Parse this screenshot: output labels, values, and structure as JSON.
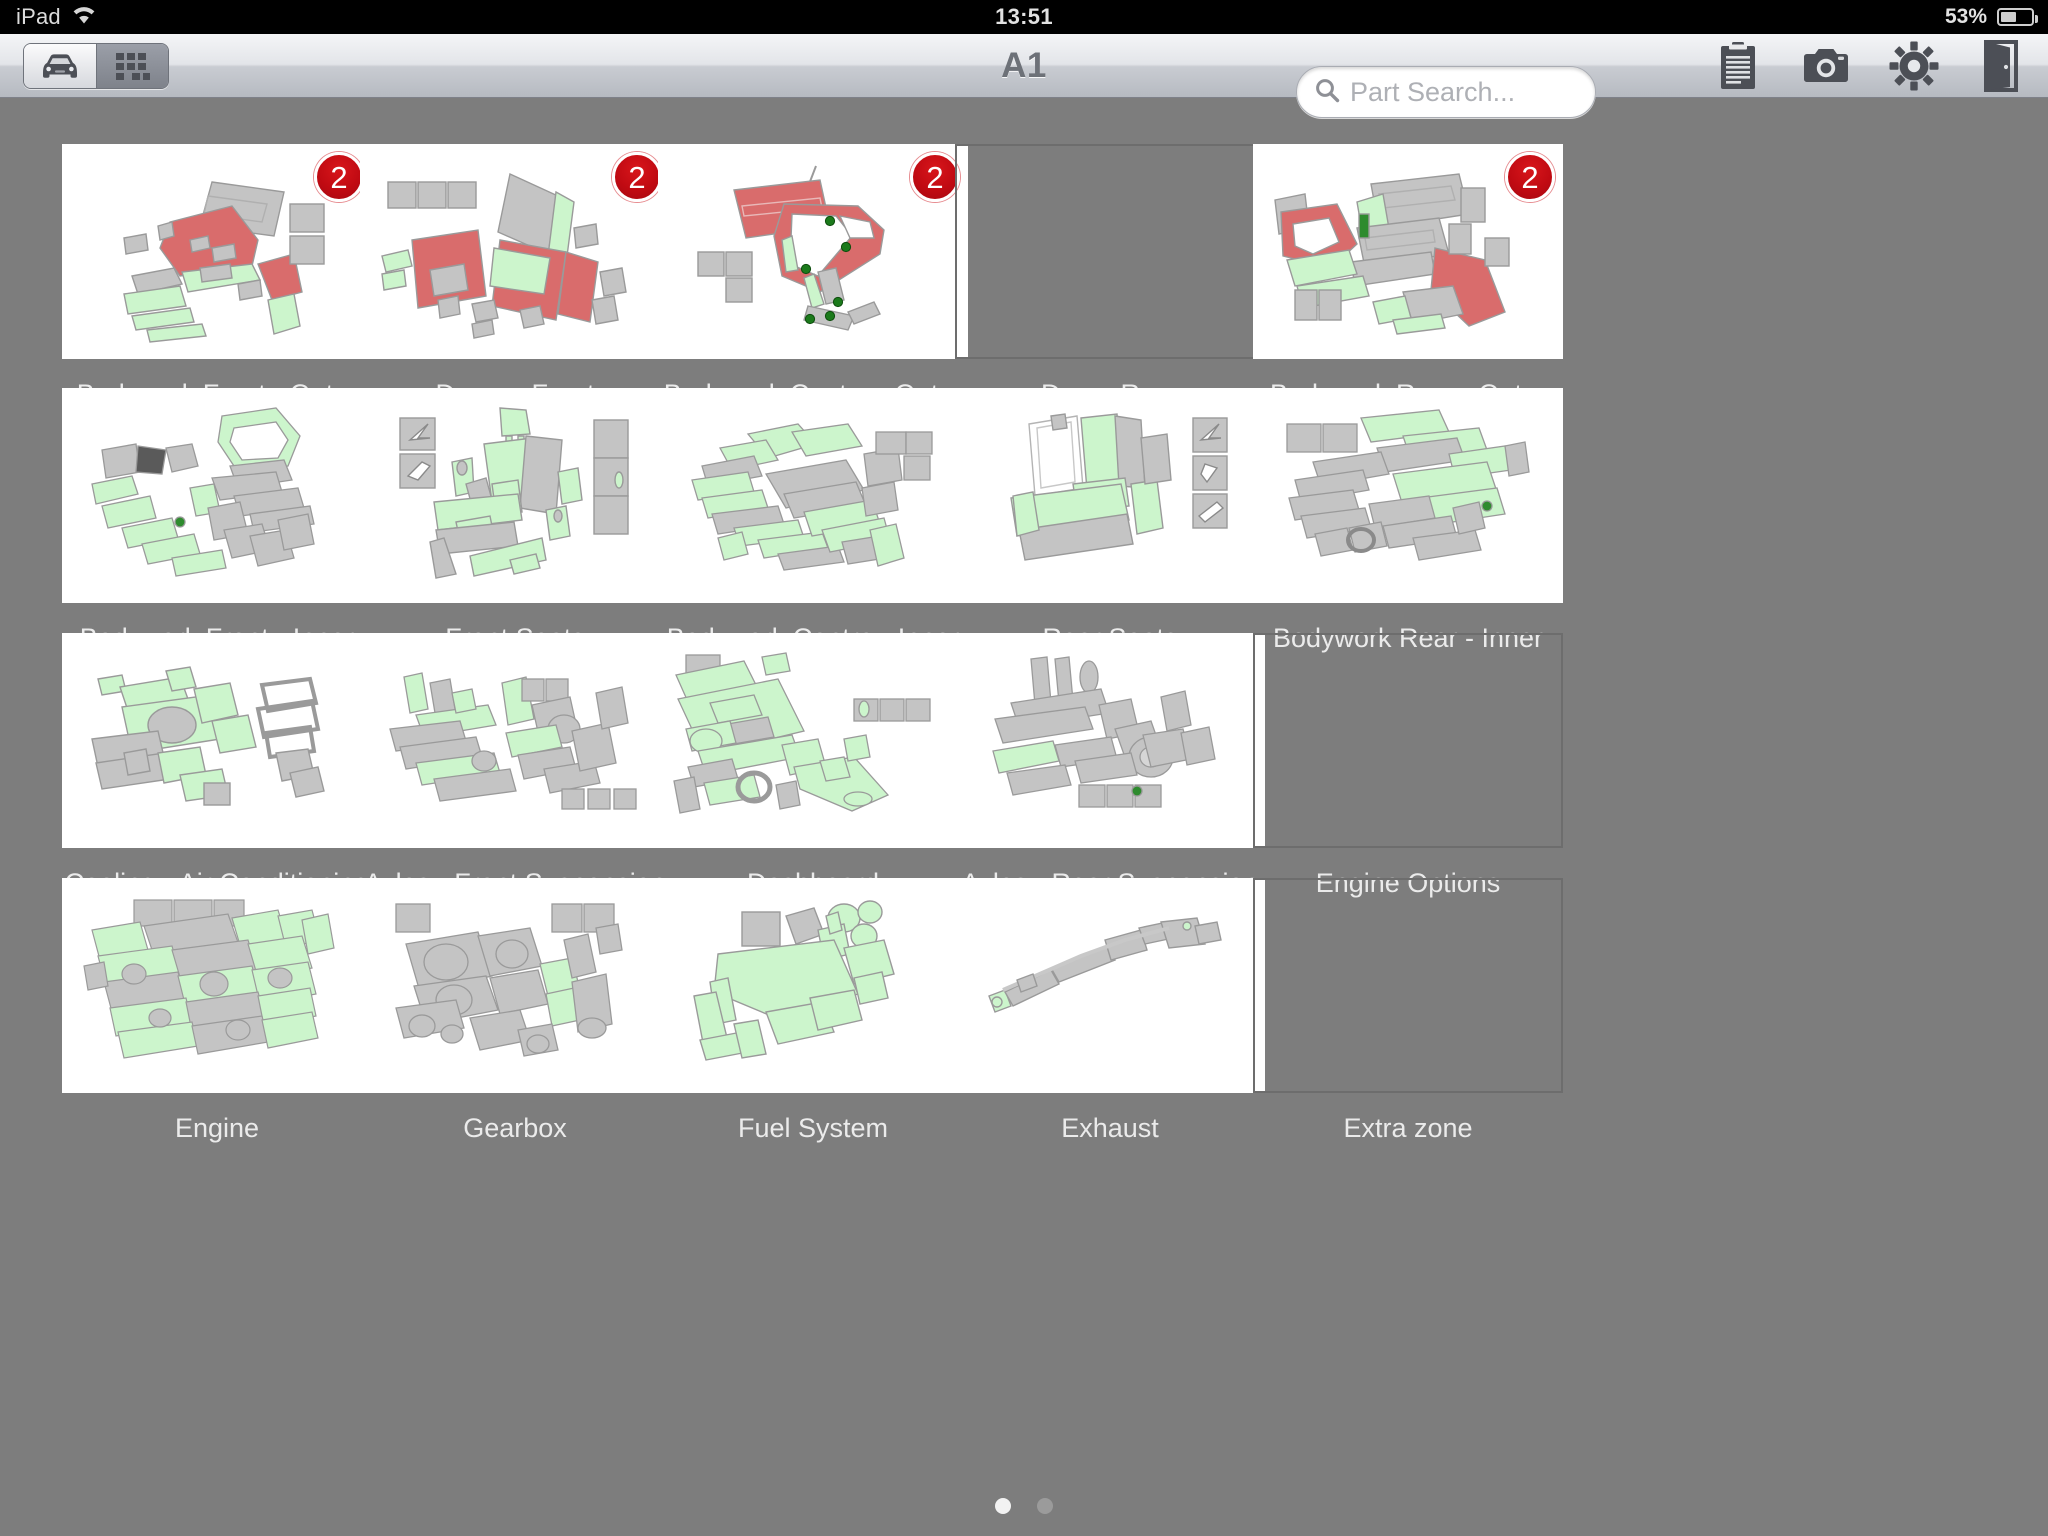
{
  "status_bar": {
    "device": "iPad",
    "wifi_icon": "wifi-icon",
    "time": "13:51",
    "battery_percent": "53%",
    "battery_level": 53
  },
  "toolbar": {
    "title": "A1",
    "segmented": {
      "options": [
        {
          "icon": "car-icon",
          "label": "Vehicle view",
          "selected": false
        },
        {
          "icon": "grid-icon",
          "label": "Grid view",
          "selected": true
        }
      ]
    },
    "search": {
      "placeholder": "Part Search...",
      "value": "",
      "icon": "search-icon"
    },
    "actions": [
      {
        "icon": "clipboard-icon",
        "label": "Job list"
      },
      {
        "icon": "camera-icon",
        "label": "Camera"
      },
      {
        "icon": "gear-icon",
        "label": "Settings"
      },
      {
        "icon": "exit-door-icon",
        "label": "Exit"
      }
    ]
  },
  "grid": {
    "columns": 5,
    "tiles": [
      {
        "label": "Bodywork Front - Outer",
        "badge": "2",
        "art": "bodywork-front-outer",
        "empty": false
      },
      {
        "label": "Doors - Front",
        "badge": "2",
        "art": "doors-front",
        "empty": false
      },
      {
        "label": "Bodywork Centre - Outer",
        "badge": "2",
        "art": "bodywork-centre-outer",
        "empty": false
      },
      {
        "label": "Doors Rear",
        "badge": null,
        "art": null,
        "empty": true
      },
      {
        "label": "Bodywork Rear - Outer",
        "badge": "2",
        "art": "bodywork-rear-outer",
        "empty": false
      },
      {
        "label": "Bodywork Front - Inner",
        "badge": null,
        "art": "bodywork-front-inner",
        "empty": false
      },
      {
        "label": "Front Seats",
        "badge": null,
        "art": "front-seats",
        "empty": false
      },
      {
        "label": "Bodywork Centre - Inner",
        "badge": null,
        "art": "bodywork-centre-inner",
        "empty": false
      },
      {
        "label": "Rear Seats",
        "badge": null,
        "art": "rear-seats",
        "empty": false
      },
      {
        "label": "Bodywork Rear - Inner",
        "badge": null,
        "art": "bodywork-rear-inner",
        "empty": false
      },
      {
        "label": "Cooling - Air Conditioning",
        "badge": null,
        "art": "cooling-air-conditioning",
        "empty": false
      },
      {
        "label": "Axles - Front Suspension",
        "badge": null,
        "art": "axles-front-suspension",
        "empty": false
      },
      {
        "label": "Dashboard",
        "badge": null,
        "art": "dashboard",
        "empty": false
      },
      {
        "label": "Axles - Rear Suspension",
        "badge": null,
        "art": "axles-rear-suspension",
        "empty": false
      },
      {
        "label": "Engine Options",
        "badge": null,
        "art": null,
        "empty": true
      },
      {
        "label": "Engine",
        "badge": null,
        "art": "engine",
        "empty": false
      },
      {
        "label": "Gearbox",
        "badge": null,
        "art": "gearbox",
        "empty": false
      },
      {
        "label": "Fuel System",
        "badge": null,
        "art": "fuel-system",
        "empty": false
      },
      {
        "label": "Exhaust",
        "badge": null,
        "art": "exhaust",
        "empty": false
      },
      {
        "label": "Extra zone",
        "badge": null,
        "art": null,
        "empty": true
      }
    ]
  },
  "pagination": {
    "pages": 2,
    "current": 1
  },
  "colors": {
    "background": "#7d7d7d",
    "tile_background": "#ffffff",
    "badge_red": "#c00a12",
    "part_green": "#ccf5cc",
    "part_red": "#d96c6c",
    "part_gray": "#c4c4c4",
    "outline_gray": "#9a9a9a",
    "label_text": "#ebebeb",
    "title_text": "#6d7178"
  }
}
